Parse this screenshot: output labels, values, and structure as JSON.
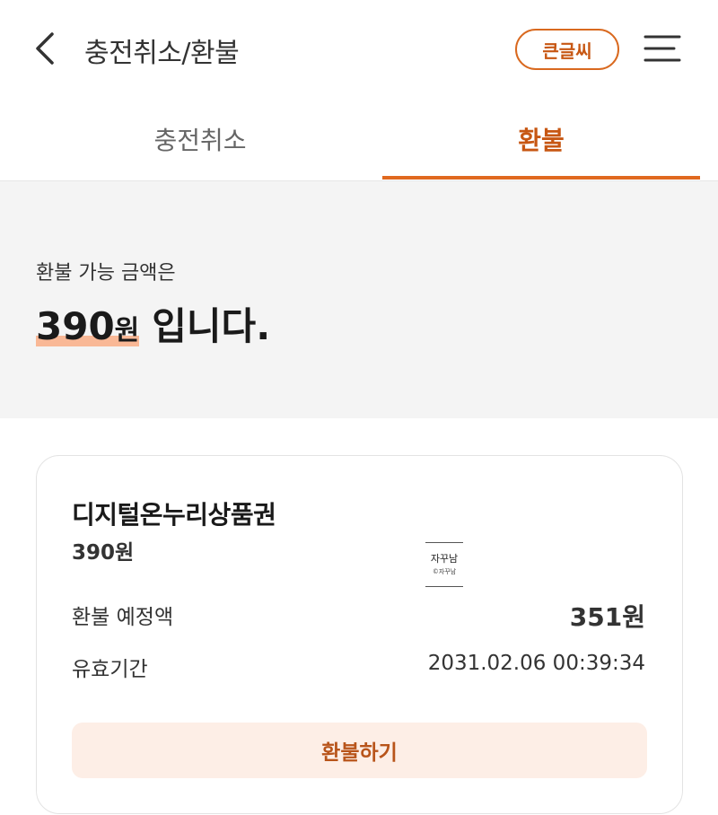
{
  "header": {
    "title": "충전취소/환불",
    "big_font_label": "큰글씨"
  },
  "tabs": [
    {
      "label": "충전취소",
      "active": false
    },
    {
      "label": "환불",
      "active": true
    }
  ],
  "summary": {
    "label": "환불 가능 금액은",
    "amount": "390",
    "unit": "원",
    "suffix": "입니다."
  },
  "card": {
    "name": "디지털온누리상품권",
    "balance": "390원",
    "logo_main": "자꾸남",
    "logo_sub": "©자꾸남",
    "expected_label": "환불 예정액",
    "expected_value": "351원",
    "valid_label": "유효기간",
    "valid_value": "2031.02.06 00:39:34",
    "refund_button": "환불하기"
  },
  "colors": {
    "accent": "#e0691f",
    "accent_text": "#c75713",
    "highlight": "#f9b896",
    "button_bg": "#fdeee6",
    "summary_bg": "#f4f4f4"
  },
  "icons": {
    "back": "chevron-left-icon",
    "menu": "hamburger-menu-icon"
  }
}
